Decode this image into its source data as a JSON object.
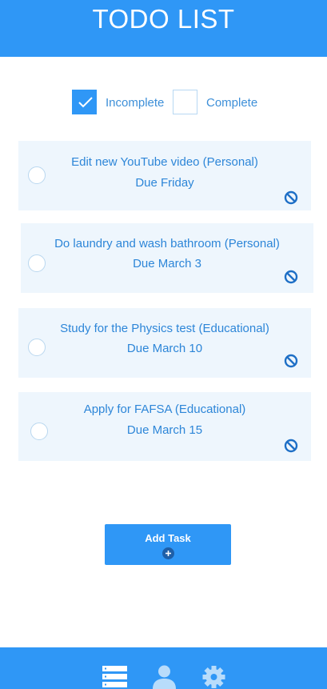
{
  "header": {
    "title": "TODO LIST"
  },
  "filters": [
    {
      "label": "Incomplete",
      "checked": true
    },
    {
      "label": "Complete",
      "checked": false
    }
  ],
  "tasks": [
    {
      "title": "Edit new YouTube video (Personal)",
      "due": "Due Friday"
    },
    {
      "title": "Do laundry and wash bathroom (Personal)",
      "due": "Due March 3"
    },
    {
      "title": "Study for the Physics test (Educational)",
      "due": "Due March 10"
    },
    {
      "title": "Apply for FAFSA (Educational)",
      "due": "Due March 15"
    }
  ],
  "add_button": {
    "label": "Add Task",
    "icon": "plus-circle-icon"
  },
  "nav": [
    {
      "icon": "list-icon"
    },
    {
      "icon": "user-icon"
    },
    {
      "icon": "gear-icon"
    }
  ],
  "colors": {
    "accent": "#2f97f6",
    "card_bg": "#eef6fd",
    "text": "#2d86d8"
  }
}
